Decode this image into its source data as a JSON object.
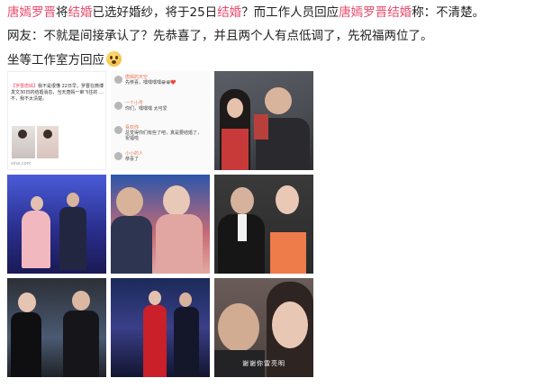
{
  "post": {
    "line1": {
      "name1": "唐嫣罗晋",
      "t1": "将",
      "word1": "结婚",
      "t2": "已选好婚纱，将于25日",
      "word2": "结婚",
      "t3": "？而工作人员回应",
      "name2": "唐嫣罗晋",
      "word3": "结婚",
      "t4": "称：不清楚。"
    },
    "line2": "网友：不就是间接承认了？先恭喜了，并且两个人有点低调了，先祝福两位了。",
    "line3": "坐等工作室方回应",
    "emoji_icon": "fearful-face-emoji"
  },
  "accent_color": "#e8496b",
  "images": {
    "screenshot": {
      "header_highlight": "【罗晋唐嫣】",
      "header_text": "我不是很懂 22日早，罗晋在微博发文30日的结婚消息，当天唐嫣一审飞往的 …不，我不太清楚。",
      "source": "sina.com"
    },
    "comments": [
      {
        "name": "唐嫣的天空",
        "text": "先恭喜，嘿嘿嘿嘿😁😁❤️"
      },
      {
        "name": "一个小号",
        "text": "你们，嘿嘿嘿 太可爱"
      },
      {
        "name": "喜欢你",
        "text": "总觉得你们有些了吧，真是要结婚了，祝福啦"
      },
      {
        "name": "小小的人",
        "text": "恭喜了"
      }
    ],
    "last_caption": "谢谢你雷亮明"
  }
}
